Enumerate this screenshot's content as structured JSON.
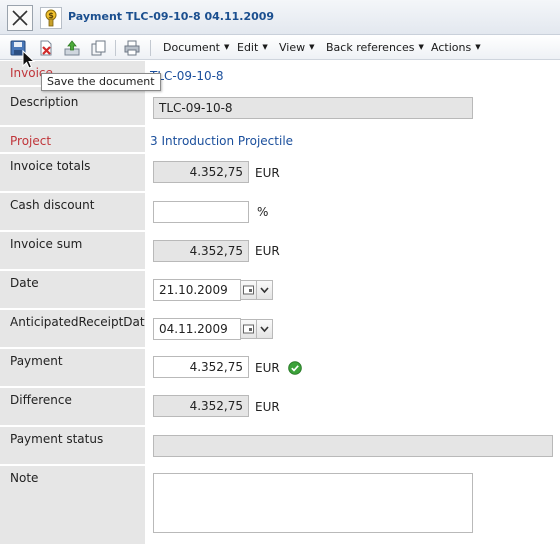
{
  "window": {
    "title": "Payment TLC-09-10-8 04.11.2009"
  },
  "toolbar": {
    "icons": [
      "save-icon",
      "delete-icon",
      "export-icon",
      "copy-icon",
      "print-icon"
    ],
    "menus": [
      {
        "label": "Document"
      },
      {
        "label": "Edit"
      },
      {
        "label": "View"
      },
      {
        "label": "Back references"
      },
      {
        "label": "Actions"
      }
    ],
    "tooltip": "Save the document"
  },
  "form": {
    "invoice": {
      "label": "Invoice",
      "value": "TLC-09-10-8"
    },
    "description": {
      "label": "Description",
      "value": "TLC-09-10-8"
    },
    "project": {
      "label": "Project",
      "value": "3 Introduction Projectile"
    },
    "invoice_totals": {
      "label": "Invoice totals",
      "value": "4.352,75",
      "unit": "EUR"
    },
    "cash_discount": {
      "label": "Cash discount",
      "value": "",
      "unit": "%"
    },
    "invoice_sum": {
      "label": "Invoice sum",
      "value": "4.352,75",
      "unit": "EUR"
    },
    "date": {
      "label": "Date",
      "value": "21.10.2009"
    },
    "anticipated_receipt_date": {
      "label": "AnticipatedReceiptDate",
      "value": "04.11.2009"
    },
    "payment": {
      "label": "Payment",
      "value": "4.352,75",
      "unit": "EUR"
    },
    "difference": {
      "label": "Difference",
      "value": "4.352,75",
      "unit": "EUR"
    },
    "payment_status": {
      "label": "Payment status",
      "value": ""
    },
    "note": {
      "label": "Note",
      "value": ""
    }
  },
  "colors": {
    "title_text": "#1b4f8f",
    "required_label": "#c0353a",
    "link": "#1b4f9c",
    "label_background": "#e6e6e6",
    "readonly_field": "#e5e5e5",
    "ok_icon": "#3ca23a"
  }
}
